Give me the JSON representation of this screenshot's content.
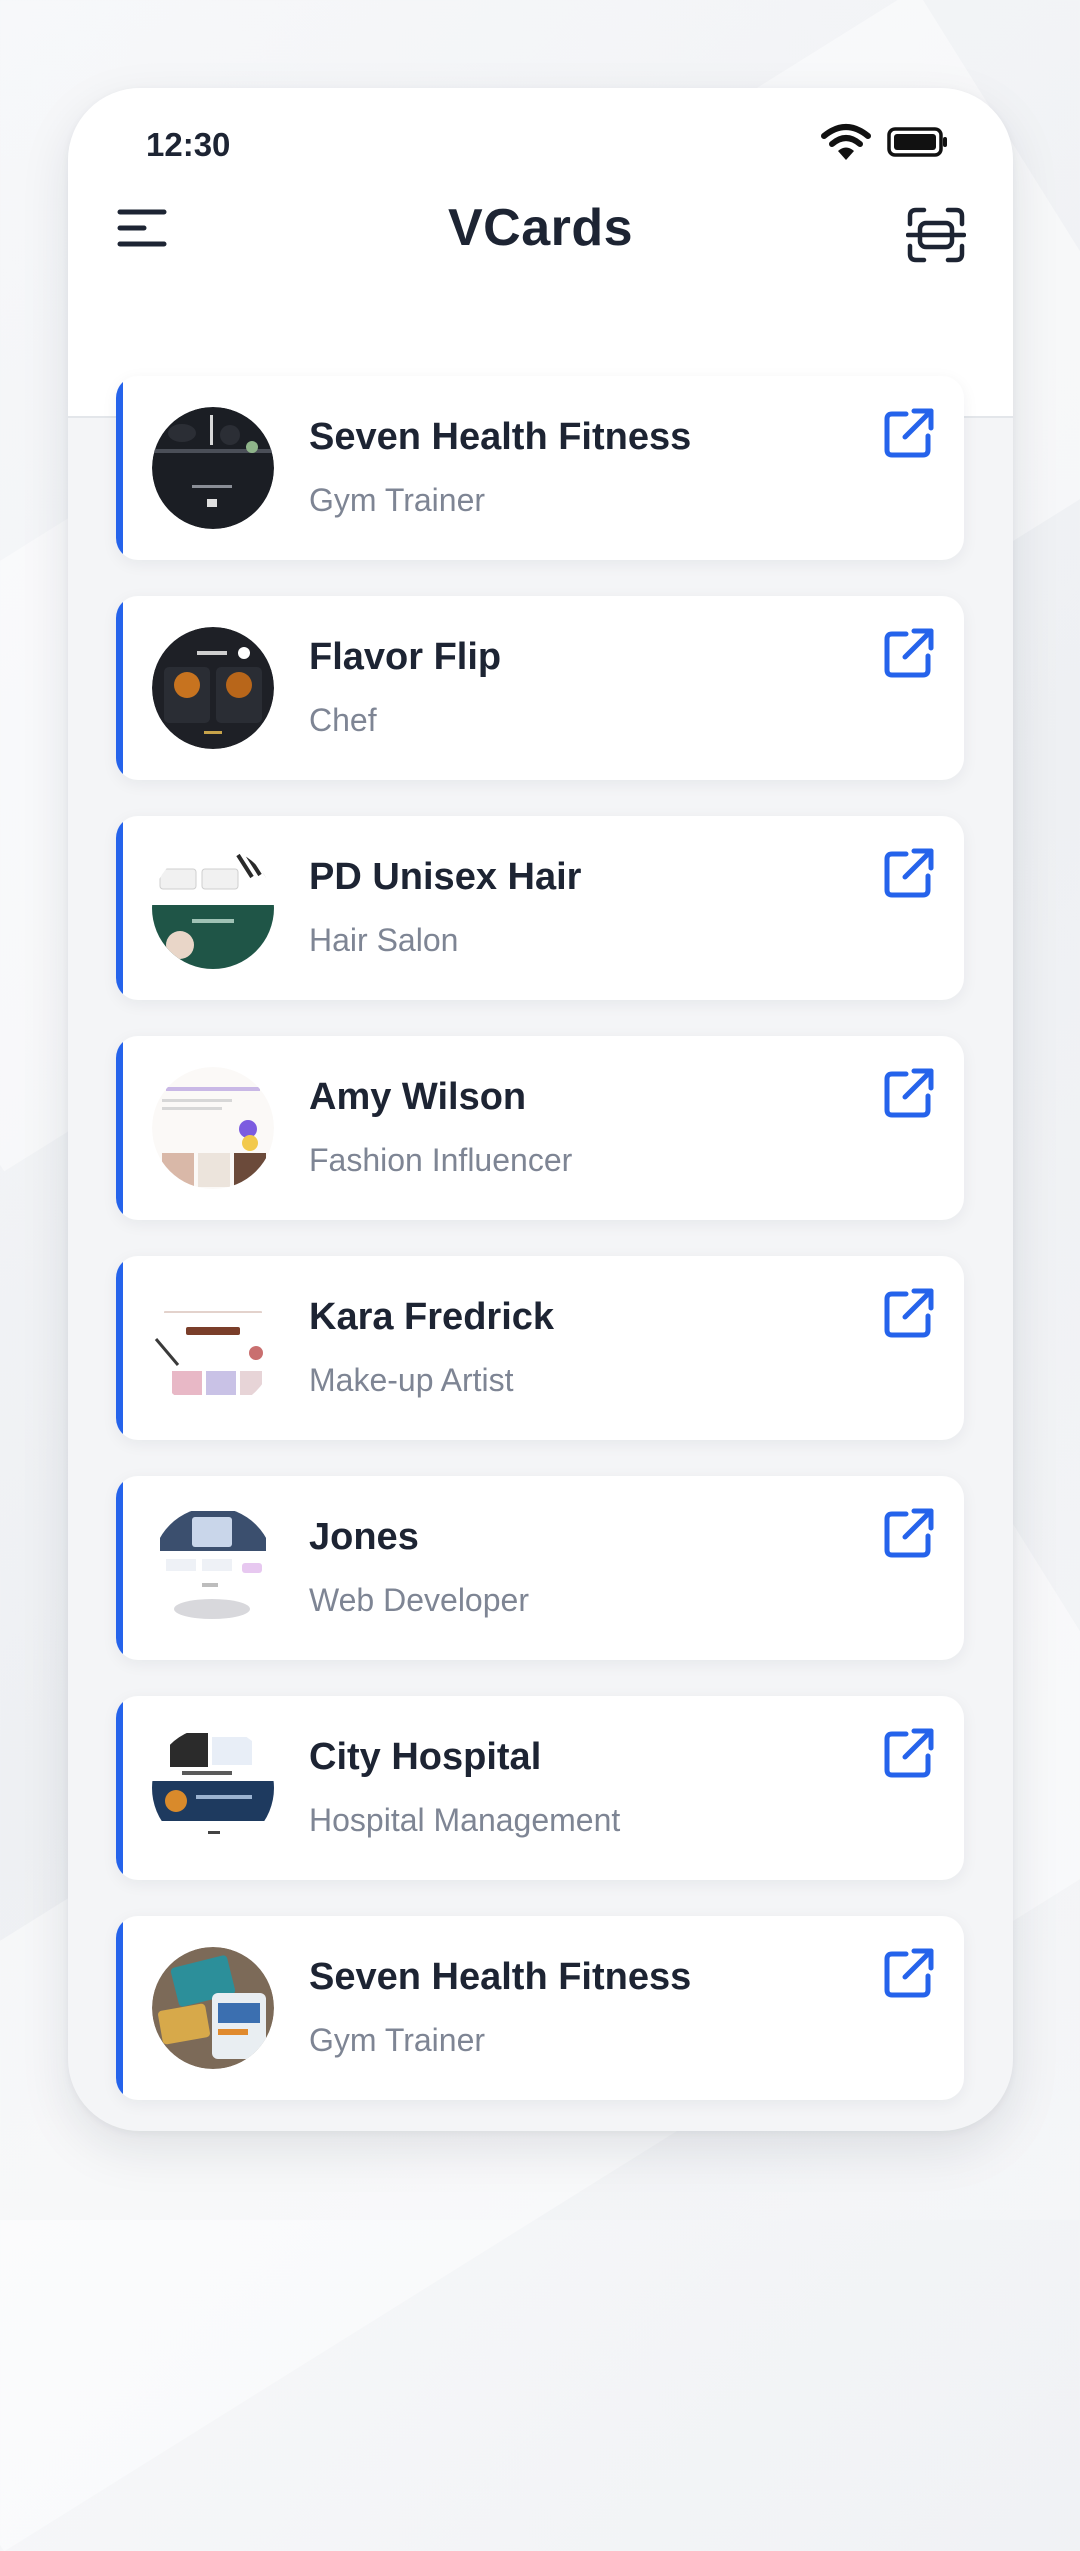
{
  "status_bar": {
    "time": "12:30",
    "icons": [
      "wifi-icon",
      "battery-icon"
    ]
  },
  "app_bar": {
    "title": "VCards",
    "left_icon": "menu-icon",
    "right_icon": "scan-icon"
  },
  "colors": {
    "accent": "#2563eb",
    "text_primary": "#1d2433",
    "text_secondary": "#7e8594",
    "card_bg": "#ffffff",
    "screen_bg": "#f4f5f7"
  },
  "vcards": [
    {
      "name": "Seven Health Fitness",
      "role": "Gym Trainer",
      "action_icon": "external-link-icon"
    },
    {
      "name": "Flavor Flip",
      "role": "Chef",
      "action_icon": "external-link-icon"
    },
    {
      "name": "PD Unisex Hair",
      "role": "Hair Salon",
      "action_icon": "external-link-icon"
    },
    {
      "name": "Amy Wilson",
      "role": "Fashion Influencer",
      "action_icon": "external-link-icon"
    },
    {
      "name": "Kara Fredrick",
      "role": "Make-up Artist",
      "action_icon": "external-link-icon"
    },
    {
      "name": "Jones",
      "role": "Web Developer",
      "action_icon": "external-link-icon"
    },
    {
      "name": "City Hospital",
      "role": "Hospital Management",
      "action_icon": "external-link-icon"
    },
    {
      "name": "Seven Health Fitness",
      "role": "Gym Trainer",
      "action_icon": "external-link-icon"
    }
  ]
}
